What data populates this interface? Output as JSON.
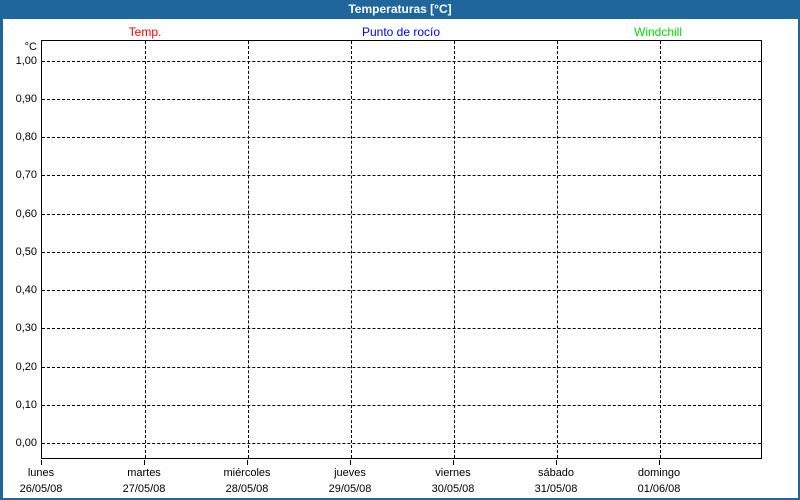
{
  "window": {
    "title": "Temperaturas [°C]"
  },
  "chart_data": {
    "type": "line",
    "title": "Temperaturas [°C]",
    "has_data": false,
    "grid": true,
    "legend_position": "top",
    "y_axis": {
      "unit": "°C",
      "ylim": [
        0.0,
        1.0
      ],
      "tick_step": 0.1,
      "ticks": [
        {
          "value": 1.0,
          "label": "1,00"
        },
        {
          "value": 0.9,
          "label": "0,90"
        },
        {
          "value": 0.8,
          "label": "0,80"
        },
        {
          "value": 0.7,
          "label": "0,70"
        },
        {
          "value": 0.6,
          "label": "0,60"
        },
        {
          "value": 0.5,
          "label": "0,50"
        },
        {
          "value": 0.4,
          "label": "0,40"
        },
        {
          "value": 0.3,
          "label": "0,30"
        },
        {
          "value": 0.2,
          "label": "0,20"
        },
        {
          "value": 0.1,
          "label": "0,10"
        },
        {
          "value": 0.0,
          "label": "0,00"
        }
      ]
    },
    "x_axis": {
      "categories": [
        {
          "day": "lunes",
          "date": "26/05/08"
        },
        {
          "day": "martes",
          "date": "27/05/08"
        },
        {
          "day": "miércoles",
          "date": "28/05/08"
        },
        {
          "day": "jueves",
          "date": "29/05/08"
        },
        {
          "day": "viernes",
          "date": "30/05/08"
        },
        {
          "day": "sábado",
          "date": "31/05/08"
        },
        {
          "day": "domingo",
          "date": "01/06/08"
        }
      ]
    },
    "series": [
      {
        "name": "Temp.",
        "color": "#F00000",
        "values": []
      },
      {
        "name": "Punto de rocío",
        "color": "#0000F0",
        "values": []
      },
      {
        "name": "Windchill",
        "color": "#00DC00",
        "values": []
      }
    ]
  },
  "colors": {
    "accent_blue": "#1F669D",
    "background": "#FDFEFD",
    "grid": "#000000",
    "title_text": "#FFFFFF"
  }
}
